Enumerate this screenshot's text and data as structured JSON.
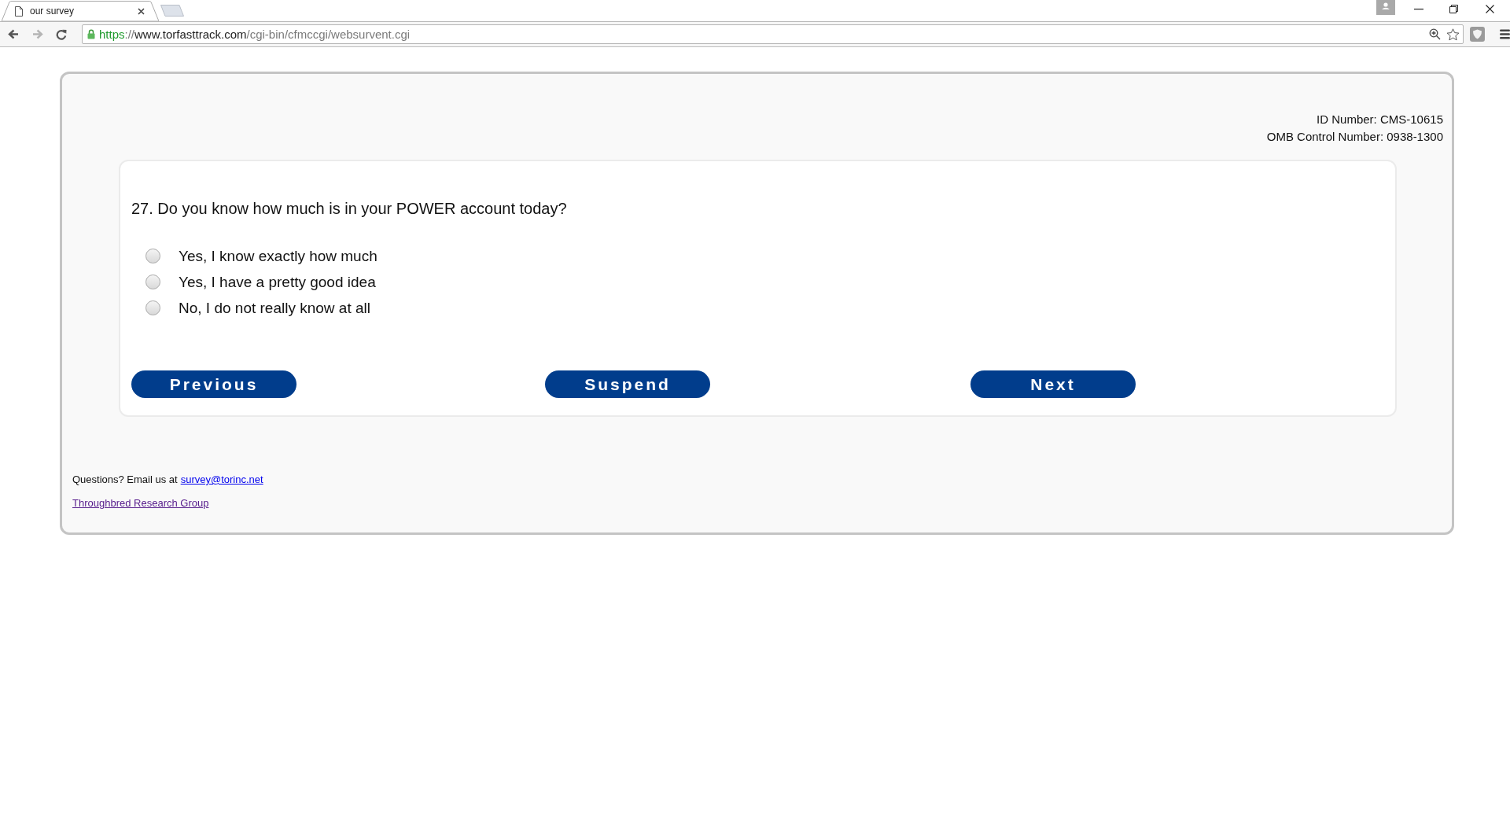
{
  "browser": {
    "tab": {
      "title": "our survey"
    },
    "back_button": {
      "disabled": false
    },
    "forward_button": {
      "disabled": true
    },
    "address_bar": {
      "secure": true,
      "url_parts": [
        {
          "kind": "scheme",
          "text": "https"
        },
        {
          "kind": "punct",
          "text": "://"
        },
        {
          "kind": "host",
          "text": "www.torfasttrack.com"
        },
        {
          "kind": "path",
          "text": "/cgi-bin/cfmccgi/websurvent.cgi"
        }
      ]
    }
  },
  "header": {
    "lines": [
      "ID Number: CMS-10615",
      "OMB Control Number: 0938-1300"
    ]
  },
  "question": {
    "text": "27. Do you know how much is in your POWER account today?",
    "options": [
      {
        "label": "Yes, I know exactly how much",
        "selected": false
      },
      {
        "label": "Yes, I have a pretty good idea",
        "selected": false
      },
      {
        "label": "No, I do not really know at all",
        "selected": false
      }
    ]
  },
  "buttons": [
    {
      "label": "Previous"
    },
    {
      "label": "Suspend"
    },
    {
      "label": "Next"
    }
  ],
  "footer": {
    "contact_text": "Questions? Email us at",
    "email_link": {
      "label": "survey@torinc.net",
      "visited": false
    },
    "org_link": {
      "label": "Throughbred Research Group",
      "visited": true
    }
  }
}
